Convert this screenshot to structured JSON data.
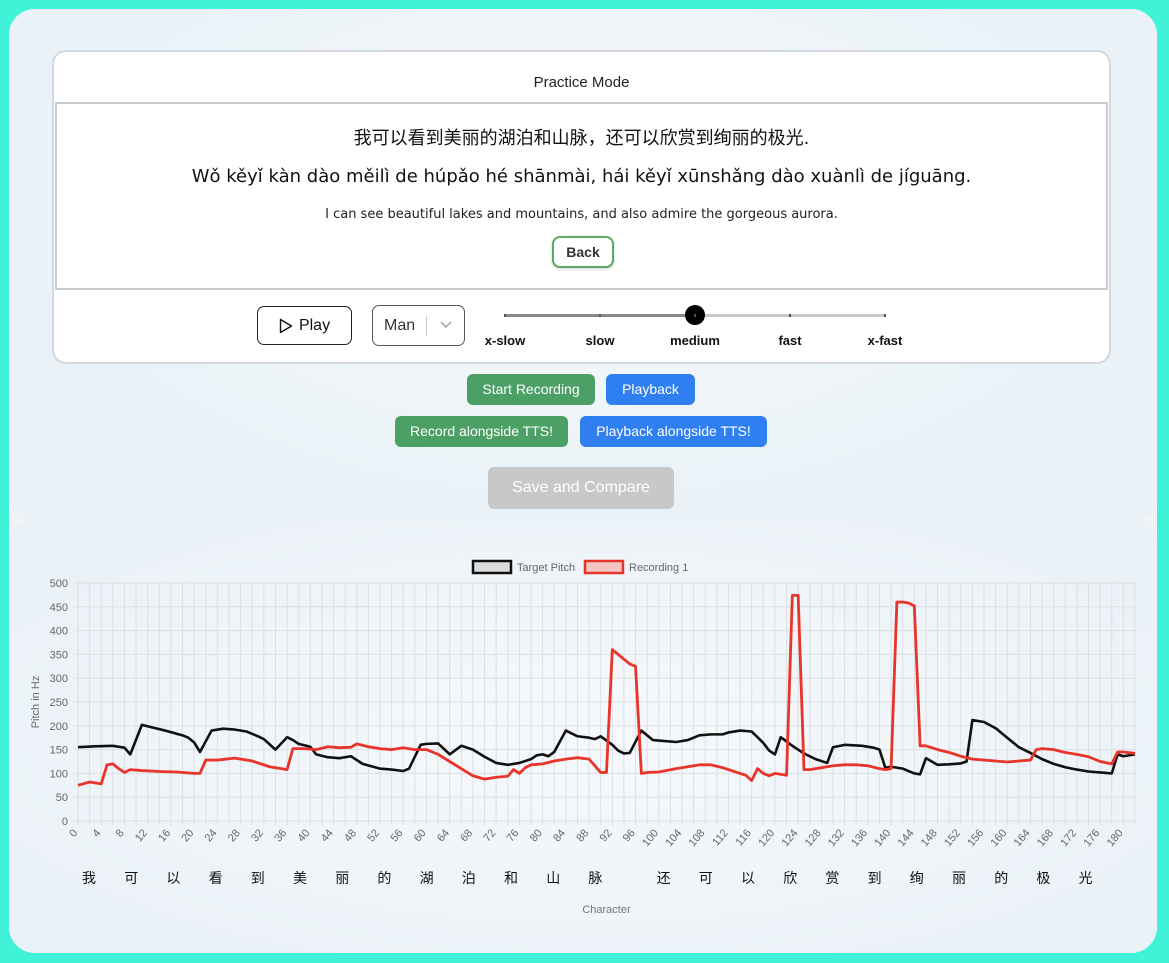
{
  "card": {
    "title": "Practice Mode",
    "hanzi": "我可以看到美丽的湖泊和山脉，还可以欣赏到绚丽的极光.",
    "pinyin": "Wǒ kěyǐ kàn dào měilì de húpǎo hé shānmài, hái kěyǐ xūnshǎng dào xuànlì de jíguāng.",
    "english": "I can see beautiful lakes and mountains, and also admire the gorgeous aurora.",
    "back_label": "Back"
  },
  "controls": {
    "play_label": "Play",
    "voice_value": "Man",
    "speed_labels": [
      "x-slow",
      "slow",
      "medium",
      "fast",
      "x-fast"
    ],
    "speed_selected_index": 2
  },
  "actions": {
    "start_recording": "Start Recording",
    "playback": "Playback",
    "record_alongside": "Record alongside TTS!",
    "playback_alongside": "Playback alongside TTS!",
    "save_compare": "Save and Compare"
  },
  "colors": {
    "green": "#4c9f65",
    "blue": "#2f7ff0",
    "target": "#111111",
    "recording": "#e8342a",
    "recording_fill": "#f3c6c4"
  },
  "chart_data": {
    "type": "line",
    "ylabel": "Pitch in Hz",
    "xlabel": "Character",
    "ylim": [
      0,
      500
    ],
    "yticks": [
      0,
      50,
      100,
      150,
      200,
      250,
      300,
      350,
      400,
      450,
      500
    ],
    "xlim": [
      0,
      182
    ],
    "xticks": [
      0,
      4,
      8,
      12,
      16,
      20,
      24,
      28,
      32,
      36,
      40,
      44,
      48,
      52,
      56,
      60,
      64,
      68,
      72,
      76,
      80,
      84,
      88,
      92,
      96,
      100,
      104,
      108,
      112,
      116,
      120,
      124,
      128,
      132,
      136,
      140,
      144,
      148,
      152,
      156,
      160,
      164,
      168,
      172,
      176,
      180
    ],
    "grid": true,
    "legend_position": "top-center",
    "characters": [
      "我",
      "可",
      "以",
      "看",
      "到",
      "美",
      "丽",
      "的",
      "湖",
      "泊",
      "和",
      "山",
      "脉",
      "还",
      "可",
      "以",
      "欣",
      "赏",
      "到",
      "绚",
      "丽",
      "的",
      "极",
      "光"
    ],
    "series": [
      {
        "name": "Target Pitch",
        "x": [
          0,
          3,
          6,
          8,
          9,
          11,
          13,
          15,
          18,
          19,
          20,
          21,
          23,
          25,
          27,
          29,
          31,
          32,
          34,
          36,
          37,
          38,
          40,
          41,
          43,
          45,
          47,
          49,
          52,
          54,
          56,
          57,
          59,
          60,
          62,
          64,
          66,
          68,
          70,
          72,
          74,
          76,
          78,
          79,
          80,
          81,
          82,
          84,
          86,
          88,
          89,
          90,
          92,
          93,
          94,
          95,
          97,
          99,
          101,
          103,
          105,
          107,
          109,
          111,
          112,
          114,
          116,
          117,
          118,
          119,
          120,
          121,
          123,
          125,
          127,
          129,
          130,
          132,
          135,
          137,
          138,
          139,
          140,
          142,
          144,
          145,
          146,
          148,
          150,
          152,
          153,
          154,
          156,
          158,
          160,
          162,
          164,
          166,
          167,
          168,
          170,
          172,
          174,
          176,
          178,
          179,
          180,
          182
        ],
        "y": [
          155,
          157,
          158,
          154,
          140,
          202,
          196,
          190,
          180,
          175,
          165,
          145,
          190,
          194,
          192,
          188,
          178,
          172,
          150,
          176,
          170,
          162,
          156,
          140,
          134,
          132,
          136,
          120,
          110,
          108,
          105,
          110,
          160,
          162,
          163,
          140,
          158,
          150,
          135,
          122,
          118,
          122,
          130,
          138,
          140,
          136,
          145,
          190,
          178,
          175,
          172,
          178,
          160,
          148,
          142,
          143,
          190,
          170,
          168,
          166,
          170,
          180,
          182,
          182,
          186,
          190,
          188,
          176,
          164,
          148,
          140,
          176,
          158,
          142,
          130,
          122,
          155,
          160,
          158,
          154,
          150,
          112,
          114,
          110,
          100,
          98,
          132,
          118,
          119,
          121,
          125,
          212,
          208,
          195,
          175,
          155,
          143,
          130,
          125,
          120,
          113,
          108,
          104,
          102,
          100,
          140,
          136,
          140
        ]
      },
      {
        "name": "Recording 1",
        "x": [
          0,
          2,
          4,
          5,
          6,
          7,
          8,
          9,
          11,
          14,
          17,
          20,
          21,
          22,
          24,
          27,
          30,
          33,
          35,
          36,
          37,
          39,
          41,
          43,
          45,
          47,
          48,
          50,
          52,
          54,
          56,
          58,
          60,
          62,
          64,
          66,
          68,
          70,
          72,
          74,
          75,
          76,
          77,
          78,
          80,
          82,
          84,
          86,
          88,
          90,
          91,
          92,
          94,
          95,
          96,
          97,
          98,
          100,
          103,
          105,
          107,
          109,
          111,
          113,
          115,
          116,
          117,
          118,
          119,
          120,
          122,
          123,
          124,
          125,
          126,
          128,
          130,
          132,
          134,
          136,
          138,
          139,
          140,
          141,
          142,
          143,
          144,
          145,
          146,
          148,
          150,
          152,
          154,
          156,
          158,
          160,
          162,
          164,
          165,
          166,
          168,
          170,
          172,
          174,
          176,
          178,
          179,
          180,
          182
        ],
        "y": [
          75,
          82,
          78,
          118,
          120,
          110,
          102,
          108,
          106,
          104,
          103,
          100,
          100,
          128,
          128,
          132,
          126,
          114,
          110,
          108,
          152,
          152,
          150,
          156,
          154,
          155,
          162,
          156,
          152,
          150,
          154,
          150,
          150,
          140,
          125,
          110,
          95,
          88,
          92,
          94,
          108,
          100,
          112,
          118,
          120,
          126,
          130,
          133,
          130,
          102,
          102,
          360,
          340,
          330,
          325,
          100,
          102,
          103,
          110,
          114,
          118,
          118,
          112,
          104,
          96,
          85,
          110,
          100,
          95,
          100,
          96,
          474,
          474,
          108,
          108,
          112,
          116,
          118,
          118,
          116,
          110,
          108,
          110,
          460,
          460,
          458,
          452,
          158,
          158,
          150,
          144,
          136,
          130,
          128,
          126,
          124,
          126,
          128,
          150,
          152,
          150,
          144,
          140,
          135,
          125,
          120,
          145,
          145,
          142
        ]
      }
    ]
  }
}
